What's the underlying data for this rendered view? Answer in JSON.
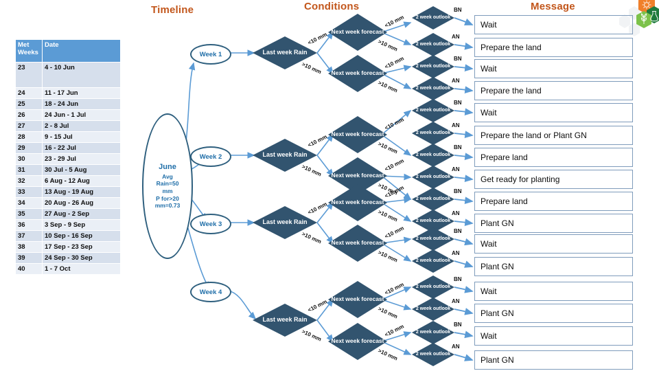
{
  "headings": {
    "timeline": "Timeline",
    "conditions": "Conditions",
    "message": "Message"
  },
  "timeline_table": {
    "columns": [
      "Met Weeks",
      "Date"
    ],
    "rows": [
      {
        "week": "23",
        "date": "4 - 10 Jun"
      },
      {
        "week": "24",
        "date": "11 - 17 Jun"
      },
      {
        "week": "25",
        "date": "18 - 24 Jun"
      },
      {
        "week": "26",
        "date": "24 Jun - 1 Jul"
      },
      {
        "week": "27",
        "date": "2 - 8 Jul"
      },
      {
        "week": "28",
        "date": "9 - 15 Jul"
      },
      {
        "week": "29",
        "date": "16 - 22 Jul"
      },
      {
        "week": "30",
        "date": "23 - 29 Jul"
      },
      {
        "week": "31",
        "date": "30 Jul - 5 Aug"
      },
      {
        "week": "32",
        "date": "6 Aug - 12 Aug"
      },
      {
        "week": "33",
        "date": "13 Aug - 19 Aug"
      },
      {
        "week": "34",
        "date": "20 Aug - 26 Aug"
      },
      {
        "week": "35",
        "date": "27 Aug - 2 Sep"
      },
      {
        "week": "36",
        "date": "3 Sep - 9 Sep"
      },
      {
        "week": "37",
        "date": "10 Sep - 16 Sep"
      },
      {
        "week": "38",
        "date": "17 Sep - 23 Sep"
      },
      {
        "week": "39",
        "date": "24 Sep - 30 Sep"
      },
      {
        "week": "40",
        "date": "1 - 7 Oct"
      }
    ]
  },
  "june_node": {
    "title": "June",
    "line1": "Avg",
    "line2": "Rain=50",
    "line3": "mm",
    "line4": "P for>20",
    "line5": "mm=0.73"
  },
  "weeks": [
    {
      "label": "Week 1"
    },
    {
      "label": "Week 2"
    },
    {
      "label": "Week 3"
    },
    {
      "label": "Week 4"
    }
  ],
  "nodes": {
    "last_week_rain": "Last week Rain",
    "next_week_forecast": "Next week forecast",
    "two_week_outlook": "2 week outlook"
  },
  "edge_labels": {
    "lt10": "<10 mm",
    "gt10": ">10 mm",
    "bn": "BN",
    "an": "AN"
  },
  "messages": [
    {
      "text": "Wait"
    },
    {
      "text": "Prepare the land"
    },
    {
      "text": "Wait"
    },
    {
      "text": "Prepare the land"
    },
    {
      "text": "Wait"
    },
    {
      "text": "Prepare the land or Plant GN"
    },
    {
      "text": "Prepare land"
    },
    {
      "text": "Get ready for planting"
    },
    {
      "text": "Prepare land"
    },
    {
      "text": "Plant GN"
    },
    {
      "text": "Wait"
    },
    {
      "text": "Plant GN"
    },
    {
      "text": "Wait"
    },
    {
      "text": "Plant GN"
    },
    {
      "text": "Wait"
    },
    {
      "text": "Plant GN"
    }
  ],
  "colors": {
    "heading": "#C2561B",
    "table_header": "#5B9BD5",
    "diamond": "#32546F",
    "connector": "#5B9BD5",
    "oval_border": "#2E5F7E",
    "oval_text": "#1F6EA8",
    "logo_orange": "#F07F2A",
    "logo_dark_green": "#1E7A3C",
    "logo_light_green": "#7CC24A"
  },
  "logo": {
    "hex_icons": [
      "sun-icon",
      "flask-icon",
      "plant-icon"
    ]
  }
}
